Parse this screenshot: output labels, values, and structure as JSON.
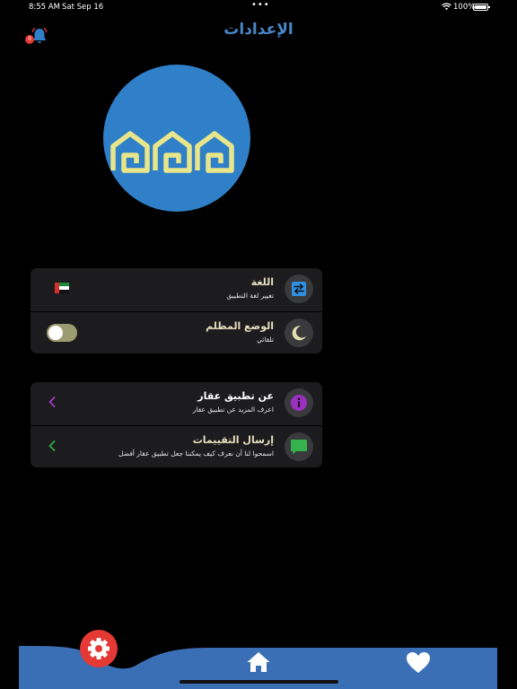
{
  "status_bar": {
    "time": "8:55 AM",
    "date": "Sat Sep 16",
    "battery": "100%",
    "dots": "•••"
  },
  "header": {
    "title": "الإعدادات",
    "notification_badge": "0"
  },
  "settings_group_1": [
    {
      "title": "اللغة",
      "subtitle": "تغيير لغة التطبيق",
      "icon": "language-swap-icon",
      "trailing": "uae-flag-icon"
    },
    {
      "title": "الوضع المظلم",
      "subtitle": "تلقائي",
      "icon": "moon-icon",
      "trailing": "toggle-switch",
      "toggle_on": false
    }
  ],
  "settings_group_2": [
    {
      "title": "عن تطبيق عقار",
      "subtitle": "اعرف المزيد عن تطبيق عقار",
      "icon": "info-icon",
      "chevron_color": "#a23cc8"
    },
    {
      "title": "إرسال التقييمات",
      "subtitle": "اسمحوا لنا أن نعرف كيف يمكننا جعل تطبيق عقار أفضل",
      "icon": "feedback-icon",
      "chevron_color": "#2eaa4a"
    }
  ],
  "tab_bar": {
    "tabs": [
      "settings-icon",
      "home-icon",
      "heart-icon"
    ],
    "active": "settings-icon"
  },
  "colors": {
    "accent_blue": "#2f80c8",
    "title_blue": "#4a86c8",
    "logo_yellow": "#e8e58a",
    "fab_red": "#e53935",
    "card_bg": "#1c1c1e"
  }
}
